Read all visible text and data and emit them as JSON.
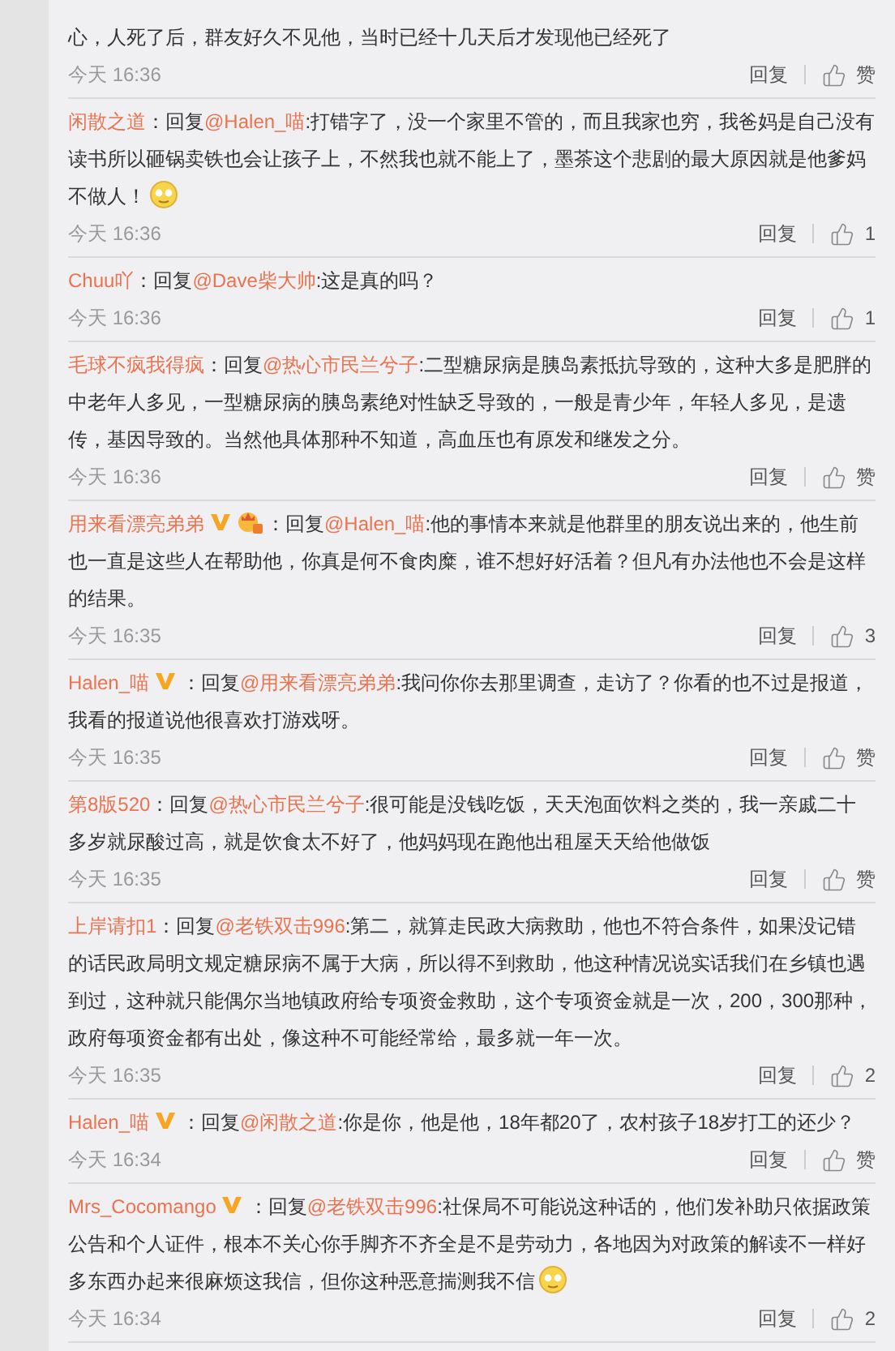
{
  "comments": [
    {
      "kind": "continued",
      "text": "心，人死了后，群友好久不见他，当时已经十几天后才发现他已经死了",
      "emoji": false,
      "time": "今天 16:36",
      "reply": "回复",
      "likes": "赞"
    },
    {
      "kind": "reply",
      "author": "闲散之道",
      "verified": false,
      "member_badge": false,
      "reply_label": "：回复",
      "mention": "@Halen_喵",
      "text": ":打错字了，没一个家里不管的，而且我家也穷，我爸妈是自己没有读书所以砸锅卖铁也会让孩子上，不然我也就不能上了，墨茶这个悲剧的最大原因就是他爹妈不做人！",
      "emoji": true,
      "time": "今天 16:36",
      "reply": "回复",
      "likes": "1"
    },
    {
      "kind": "reply",
      "author": "Chuu吖",
      "verified": false,
      "member_badge": false,
      "reply_label": "：回复",
      "mention": "@Dave柴大帅",
      "text": ":这是真的吗？",
      "emoji": false,
      "time": "今天 16:36",
      "reply": "回复",
      "likes": "1"
    },
    {
      "kind": "reply",
      "author": "毛球不疯我得疯",
      "verified": false,
      "member_badge": false,
      "reply_label": "：回复",
      "mention": "@热心市民兰兮子",
      "text": ":二型糖尿病是胰岛素抵抗导致的，这种大多是肥胖的中老年人多见，一型糖尿病的胰岛素绝对性缺乏导致的，一般是青少年，年轻人多见，是遗传，基因导致的。当然他具体那种不知道，高血压也有原发和继发之分。",
      "emoji": false,
      "time": "今天 16:36",
      "reply": "回复",
      "likes": "赞"
    },
    {
      "kind": "reply",
      "author": "用来看漂亮弟弟",
      "verified": true,
      "member_badge": true,
      "reply_label": "：回复",
      "mention": "@Halen_喵",
      "text": ":他的事情本来就是他群里的朋友说出来的，他生前也一直是这些人在帮助他，你真是何不食肉糜，谁不想好好活着？但凡有办法他也不会是这样的结果。",
      "emoji": false,
      "time": "今天 16:35",
      "reply": "回复",
      "likes": "3"
    },
    {
      "kind": "reply",
      "author": "Halen_喵",
      "verified": true,
      "member_badge": false,
      "reply_label": "：回复",
      "mention": "@用来看漂亮弟弟",
      "text": ":我问你你去那里调查，走访了？你看的也不过是报道，我看的报道说他很喜欢打游戏呀。",
      "emoji": false,
      "time": "今天 16:35",
      "reply": "回复",
      "likes": "赞"
    },
    {
      "kind": "reply",
      "author": "第8版520",
      "verified": false,
      "member_badge": false,
      "reply_label": "：回复",
      "mention": "@热心市民兰兮子",
      "text": ":很可能是没钱吃饭，天天泡面饮料之类的，我一亲戚二十多岁就尿酸过高，就是饮食太不好了，他妈妈现在跑他出租屋天天给他做饭",
      "emoji": false,
      "time": "今天 16:35",
      "reply": "回复",
      "likes": "赞"
    },
    {
      "kind": "reply",
      "author": "上岸请扣1",
      "verified": false,
      "member_badge": false,
      "reply_label": "：回复",
      "mention": "@老铁双击996",
      "text": ":第二，就算走民政大病救助，他也不符合条件，如果没记错的话民政局明文规定糖尿病不属于大病，所以得不到救助，他这种情况说实话我们在乡镇也遇到过，这种就只能偶尔当地镇政府给专项资金救助，这个专项资金就是一次，200，300那种，政府每项资金都有出处，像这种不可能经常给，最多就一年一次。",
      "emoji": false,
      "time": "今天 16:35",
      "reply": "回复",
      "likes": "2"
    },
    {
      "kind": "reply",
      "author": "Halen_喵",
      "verified": true,
      "member_badge": false,
      "reply_label": "：回复",
      "mention": "@闲散之道",
      "text": ":你是你，他是他，18年都20了，农村孩子18岁打工的还少？",
      "emoji": false,
      "time": "今天 16:34",
      "reply": "回复",
      "likes": "赞"
    },
    {
      "kind": "reply",
      "author": "Mrs_Cocomango",
      "verified": true,
      "member_badge": false,
      "reply_label": "：回复",
      "mention": "@老铁双击996",
      "text": ":社保局不可能说这种话的，他们发补助只依据政策公告和个人证件，根本不关心你手脚齐不齐全是不是劳动力，各地因为对政策的解读不一样好多东西办起来很麻烦这我信，但你这种恶意揣测我不信",
      "emoji": true,
      "time": "今天 16:34",
      "reply": "回复",
      "likes": "2"
    }
  ]
}
